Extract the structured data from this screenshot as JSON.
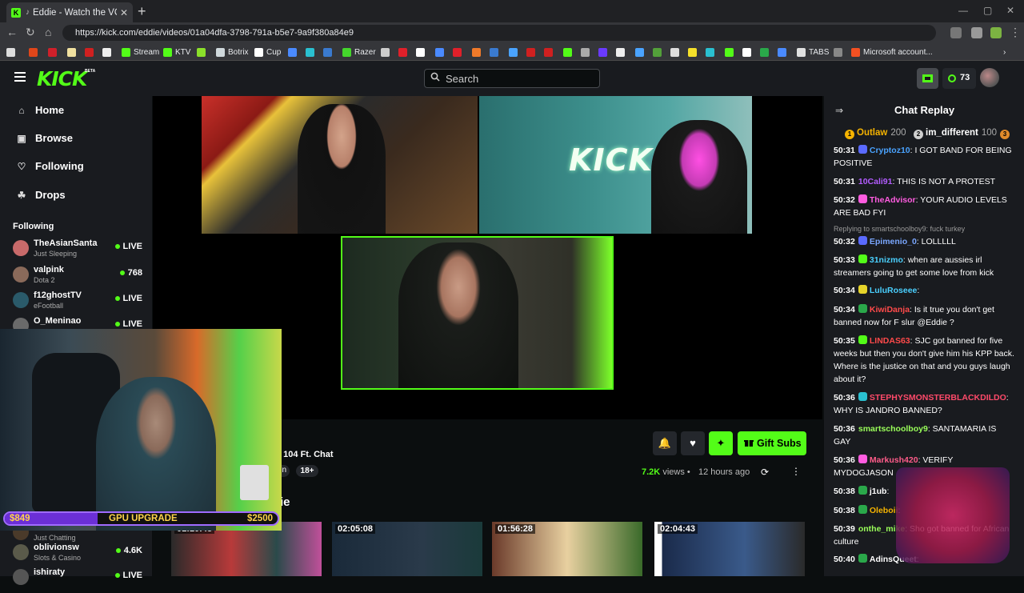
{
  "browser": {
    "tab_title": "Eddie - Watch the VOD on Ki",
    "url": "https://kick.com/eddie/videos/01a04dfa-3798-791a-b5e7-9a9f380a84e9",
    "bookmarks": [
      {
        "label": "Stream",
        "color": "#53fc18"
      },
      {
        "label": "KTV",
        "color": "#53fc18"
      },
      {
        "label": "Botrix",
        "color": "#cfd8dc"
      },
      {
        "label": "Cup",
        "color": "#ffffff"
      },
      {
        "label": "Razer",
        "color": "#44d62c"
      },
      {
        "label": "TABS",
        "color": "#e0e0e0"
      },
      {
        "label": "Microsoft account...",
        "color": "#f25022"
      }
    ]
  },
  "header": {
    "logo": "KICK",
    "beta": "BETA",
    "search_placeholder": "Search",
    "points": "73"
  },
  "sidebar": {
    "nav": [
      {
        "label": "Home",
        "icon": "home-icon"
      },
      {
        "label": "Browse",
        "icon": "browse-icon"
      },
      {
        "label": "Following",
        "icon": "heart-icon"
      },
      {
        "label": "Drops",
        "icon": "drops-icon"
      }
    ],
    "following_heading": "Following",
    "following": [
      {
        "name": "TheAsianSanta",
        "category": "Just Sleeping",
        "status": "LIVE",
        "avatar_color": "#c86a6a"
      },
      {
        "name": "valpink",
        "category": "Dota 2",
        "status": "768",
        "avatar_color": "#8a6a5a"
      },
      {
        "name": "f12ghostTV",
        "category": "eFootball",
        "status": "LIVE",
        "avatar_color": "#2a5a6a"
      },
      {
        "name": "O_Meninao",
        "category": "",
        "status": "LIVE",
        "avatar_color": "#6a6a6a"
      }
    ],
    "following_bottom": [
      {
        "name": "",
        "category": "Just Chatting",
        "status": "",
        "avatar_color": "#4a3a2a"
      },
      {
        "name": "oblivionsw",
        "category": "Slots & Casino",
        "status": "4.6K",
        "avatar_color": "#5a5a4a"
      },
      {
        "name": "ishiraty",
        "category": "",
        "status": "LIVE",
        "avatar_color": "#555555"
      }
    ]
  },
  "overlay": {
    "goal_left": "$849",
    "goal_label": "GPU UPGRADE",
    "goal_right": "$2500",
    "goal_fraction": 0.34,
    "live_badge": "LIVE"
  },
  "video": {
    "title_fragment": "e 104 Ft. Chat",
    "tag_fragment": "n",
    "tag_age": "18+",
    "views": "7.2K",
    "views_suffix": "views",
    "dot": "•",
    "ago": "12 hours ago",
    "section_fragment": "ie",
    "gift_label": "Gift Subs",
    "thumbnails": [
      {
        "duration": "01:10:48"
      },
      {
        "duration": "02:05:08"
      },
      {
        "duration": "01:56:28"
      },
      {
        "duration": "02:04:43"
      }
    ]
  },
  "chat": {
    "title": "Chat Replay",
    "leaders": [
      {
        "rank": "1",
        "name": "Outlaw",
        "amount": "200",
        "color": "#f5b300"
      },
      {
        "rank": "2",
        "name": "im_different",
        "amount": "100",
        "color": "#cfcfcf"
      },
      {
        "rank": "3",
        "name": "",
        "amount": "",
        "color": "#e08a2a"
      }
    ],
    "reply_note": "Replying to smartschoolboy9: fuck turkey",
    "messages": [
      {
        "ts": "50:31",
        "user": "Cryptoz10",
        "color": "#4aa3ff",
        "text": ": I GOT BAND FOR BEING POSITIVE",
        "badge": "#5a6aff"
      },
      {
        "ts": "50:31",
        "user": "10Cali91",
        "color": "#b35cff",
        "text": ": THIS IS NOT A PROTEST",
        "badge": ""
      },
      {
        "ts": "50:32",
        "user": "TheAdvisor",
        "color": "#ff5ce0",
        "text": ": YOUR AUDIO LEVELS ARE BAD FYI",
        "badge": "#ff5ce0"
      },
      {
        "ts": "50:32",
        "user": "Epimenio_0",
        "color": "#7aa7ff",
        "text": ": LOLLLLL",
        "badge": "#5a6aff"
      },
      {
        "ts": "50:33",
        "user": "31nizmo",
        "color": "#4ad0ff",
        "text": ": when are aussies irl streamers going to get some love from kick",
        "badge": "#53fc18"
      },
      {
        "ts": "50:34",
        "user": "LuluRoseee",
        "color": "#4ad0ff",
        "text": ":",
        "badge": "#e6d42a"
      },
      {
        "ts": "50:34",
        "user": "KiwiDanja",
        "color": "#ff4a4a",
        "text": ": Is it true you don't get banned now for F slur @Eddie ?",
        "badge": "#2aa84a"
      },
      {
        "ts": "50:35",
        "user": "LINDAS63",
        "color": "#ff4a4a",
        "text": ": SJC got banned for five weeks but then you don't give him his KPP back. Where is the justice on that and you guys laugh about it?",
        "badge": "#53fc18"
      },
      {
        "ts": "50:36",
        "user": "STEPHYSMONSTERBLACKDILDO",
        "color": "#ff4a6a",
        "text": ": WHY IS JANDRO BANNED?",
        "badge": "#2ac0d0"
      },
      {
        "ts": "50:36",
        "user": "smartschoolboy9",
        "color": "#9aff5a",
        "text": ": SANTAMARIA IS GAY",
        "badge": ""
      },
      {
        "ts": "50:36",
        "user": "Markush420",
        "color": "#ff5c8a",
        "text": ": VERIFY MYDOGJASON",
        "badge": "#ff5ce0"
      },
      {
        "ts": "50:38",
        "user": "j1ub",
        "color": "#ffffff",
        "text": ":",
        "badge": "#2aa84a"
      },
      {
        "ts": "50:38",
        "user": "Oleboii",
        "color": "#f5b300",
        "text": ":",
        "badge": "#2aa84a"
      },
      {
        "ts": "50:39",
        "user": "onthe_mike",
        "color": "#9aff5a",
        "text": ": Sho got banned for African culture",
        "badge": ""
      },
      {
        "ts": "50:40",
        "user": "AdinsQueet",
        "color": "#ffffff",
        "text": ":",
        "badge": "#2aa84a"
      }
    ]
  }
}
